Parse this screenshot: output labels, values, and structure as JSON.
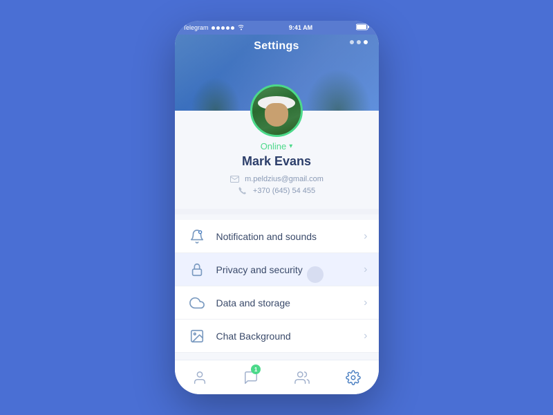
{
  "statusBar": {
    "carrier": "Telegram",
    "time": "9:41 AM",
    "battery": "▐"
  },
  "header": {
    "title": "Settings",
    "dots": [
      false,
      false,
      true
    ]
  },
  "profile": {
    "status": "Online",
    "name": "Mark Evans",
    "email": "m.peldzius@gmail.com",
    "phone": "+370 (645) 54 455"
  },
  "menu": {
    "items": [
      {
        "id": "notifications",
        "label": "Notification and sounds",
        "icon": "bell"
      },
      {
        "id": "privacy",
        "label": "Privacy and security",
        "icon": "lock"
      },
      {
        "id": "data",
        "label": "Data and storage",
        "icon": "cloud"
      },
      {
        "id": "chat-bg",
        "label": "Chat Background",
        "icon": "image"
      }
    ]
  },
  "tabs": [
    {
      "id": "profile",
      "icon": "person",
      "active": false,
      "badge": null
    },
    {
      "id": "messages",
      "icon": "chat",
      "active": false,
      "badge": "1"
    },
    {
      "id": "contacts",
      "icon": "people",
      "active": false,
      "badge": null
    },
    {
      "id": "settings",
      "icon": "gear",
      "active": true,
      "badge": null
    }
  ]
}
